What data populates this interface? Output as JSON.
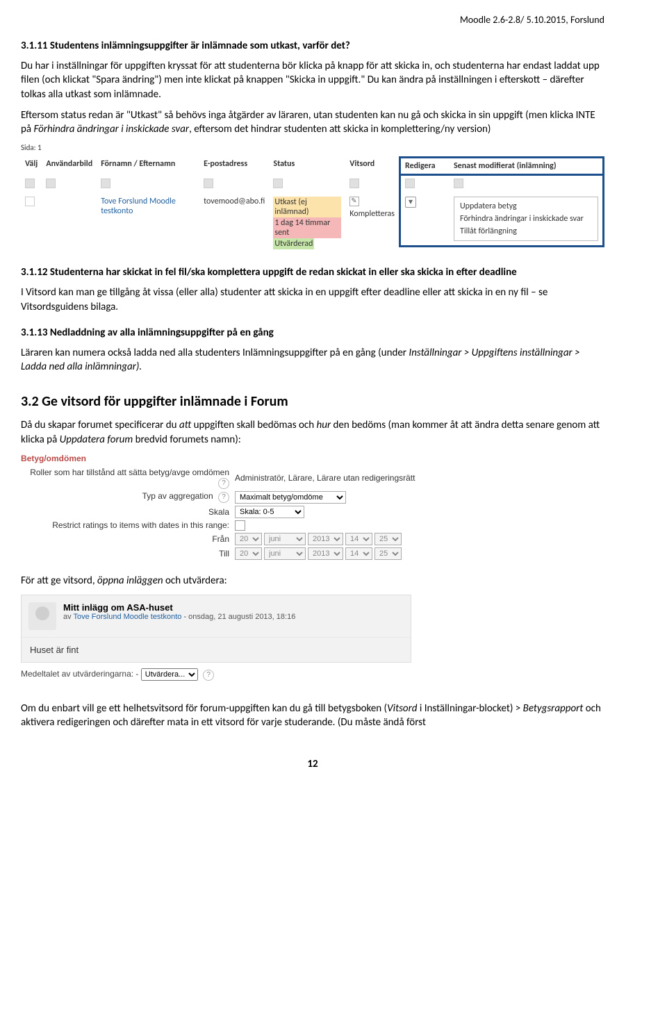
{
  "header": "Moodle 2.6-2.8/ 5.10.2015,  Forslund",
  "sec_3_1_11": {
    "title": "3.1.11 Studentens inlämningsuppgifter är inlämnade som utkast, varför det?",
    "p1": "Du har i inställningar för uppgiften kryssat för att studenterna bör klicka på knapp för att skicka in, och studenterna har endast laddat upp filen (och klickat \"Spara ändring\") men inte klickat på knappen \"Skicka in uppgift.\" Du kan ändra på inställningen i efterskott – därefter tolkas alla utkast som inlämnade.",
    "p2a": "Eftersom status redan är \"Utkast\" så behövs inga åtgärder av läraren, utan studenten kan nu gå och skicka in sin uppgift (men klicka INTE på ",
    "p2i": "Förhindra ändringar i inskickade svar",
    "p2b": ", eftersom det hindrar studenten att skicka in komplettering/ny version)",
    "sida": "Sida: 1"
  },
  "gtable": {
    "headers": [
      "Välj",
      "Användarbild",
      "Förnamn / Efternamn",
      "E-postadress",
      "Status",
      "Vitsord",
      "Redigera",
      "Senast modifierat (inlämning)"
    ],
    "row": {
      "name": "Tove Forslund Moodle testkonto",
      "email": "tovemood@abo.fi",
      "status1": "Utkast (ej inlämnad)",
      "status2": "1 dag 14 timmar sent",
      "status3": "Utvärderad",
      "vitsord": "Kompletteras"
    },
    "menu": [
      "Uppdatera betyg",
      "Förhindra ändringar i inskickade svar",
      "Tillåt förlängning"
    ]
  },
  "sec_3_1_12": {
    "title": "3.1.12 Studenterna har skickat in fel fil/ska komplettera uppgift de redan skickat in eller ska skicka in efter deadline",
    "p": "I Vitsord kan man ge tillgång åt vissa (eller alla) studenter att skicka in en uppgift efter deadline eller att skicka in en ny fil – se Vitsordsguidens bilaga."
  },
  "sec_3_1_13": {
    "title": "3.1.13 Nedladdning av alla inlämningsuppgifter på en gång",
    "p_a": "Läraren kan numera också ladda ned alla studenters Inlämningsuppgifter på en gång (under ",
    "p_i": "Inställningar > Uppgiftens inställningar > Ladda ned alla inlämningar).",
    "p_b": ""
  },
  "sec_3_2": {
    "title": "3.2 Ge vitsord för uppgifter inlämnade i Forum",
    "p1a": "Då du skapar forumet specificerar du ",
    "p1i1": "att",
    "p1b": " uppgiften skall bedömas och ",
    "p1i2": "hur",
    "p1c": " den bedöms (man kommer åt att ändra detta senare genom att klicka på ",
    "p1i3": "Uppdatera forum",
    "p1d": " bredvid forumets namn):"
  },
  "betyg": {
    "title": "Betyg/omdömen",
    "roles_label": "Roller som har tillstånd att sätta betyg/avge omdömen",
    "roles_value": "Administratör, Lärare, Lärare utan redigeringsrätt",
    "agg_label": "Typ av aggregation",
    "agg_value": "Maximalt betyg/omdöme",
    "skala_label": "Skala",
    "skala_value": "Skala: 0-5",
    "restrict_label": "Restrict ratings to items with dates in this range:",
    "from_label": "Från",
    "to_label": "Till",
    "date_parts": {
      "day": "20",
      "month": "juni",
      "year": "2013",
      "hour": "14",
      "min": "25"
    }
  },
  "sec_3_2b": {
    "p_a": "För att ge vitsord, ",
    "p_i": "öppna inläggen",
    "p_b": " och utvärdera:"
  },
  "forum": {
    "subject": "Mitt inlägg om ASA-huset",
    "by_a": "av ",
    "by_link": "Tove Forslund Moodle testkonto",
    "by_b": " - onsdag, 21 augusti 2013, 18:16",
    "body": "Huset är fint",
    "rating_label": "Medeltalet av utvärderingarna: -",
    "rating_value": "Utvärdera..."
  },
  "sec_3_2c": {
    "p_a": "Om du enbart vill ge ett helhetsvitsord för forum-uppgiften kan du gå till betygsboken (",
    "p_i1": "Vitsord",
    "p_b": " i Inställningar-blocket) > ",
    "p_i2": "Betygsrapport",
    "p_c": " och aktivera redigeringen och därefter mata in ett vitsord för varje studerande. (Du måste ändå först"
  },
  "pagenum": "12"
}
